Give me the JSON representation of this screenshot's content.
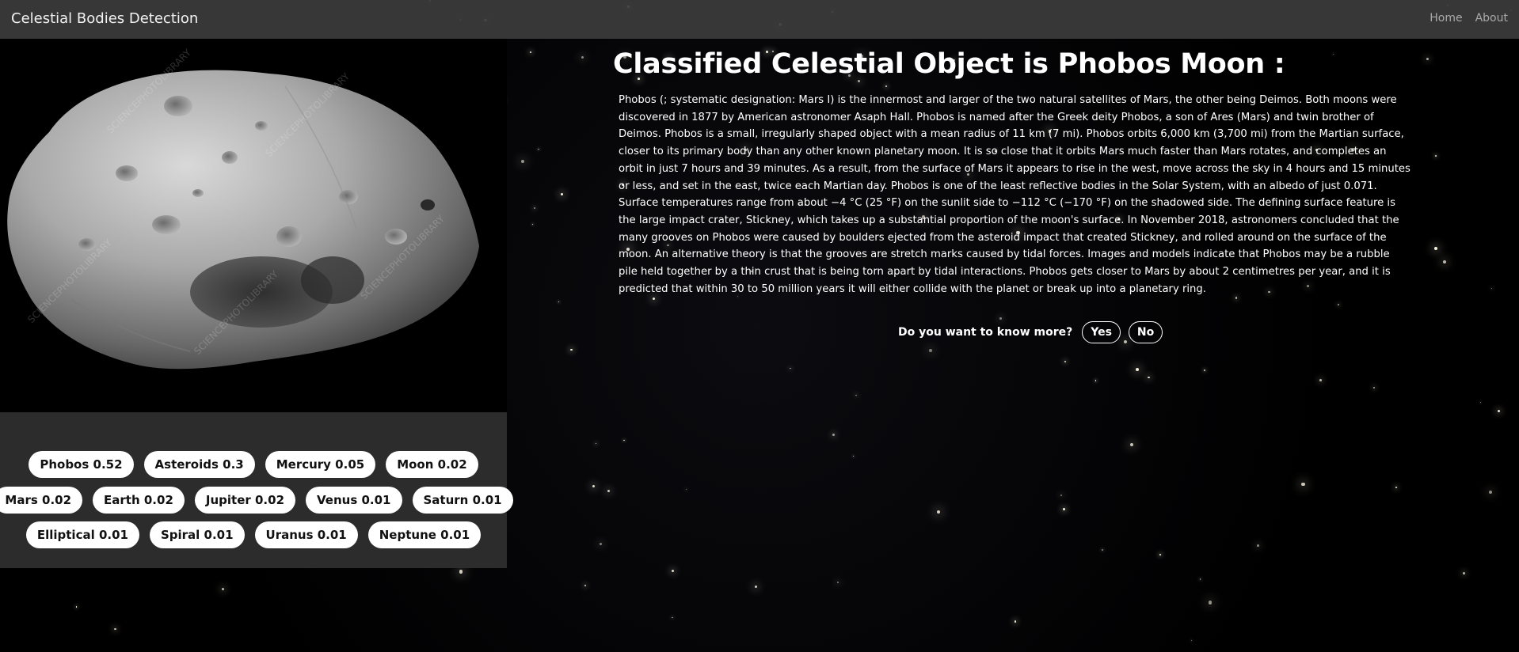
{
  "navbar": {
    "brand": "Celestial Bodies Detection",
    "links": [
      "Home",
      "About"
    ]
  },
  "classification": {
    "title": "Classified Celestial Object is Phobos Moon :",
    "description": "Phobos (; systematic designation: Mars I) is the innermost and larger of the two natural satellites of Mars, the other being Deimos. Both moons were discovered in 1877 by American astronomer Asaph Hall. Phobos is named after the Greek deity Phobos, a son of Ares (Mars) and twin brother of Deimos. Phobos is a small, irregularly shaped object with a mean radius of 11 km (7 mi). Phobos orbits 6,000 km (3,700 mi) from the Martian surface, closer to its primary body than any other known planetary moon. It is so close that it orbits Mars much faster than Mars rotates, and completes an orbit in just 7 hours and 39 minutes. As a result, from the surface of Mars it appears to rise in the west, move across the sky in 4 hours and 15 minutes or less, and set in the east, twice each Martian day. Phobos is one of the least reflective bodies in the Solar System, with an albedo of just 0.071. Surface temperatures range from about −4 °C (25 °F) on the sunlit side to −112 °C (−170 °F) on the shadowed side. The defining surface feature is the large impact crater, Stickney, which takes up a substantial proportion of the moon's surface. In November 2018, astronomers concluded that the many grooves on Phobos were caused by boulders ejected from the asteroid impact that created Stickney, and rolled around on the surface of the moon. An alternative theory is that the grooves are stretch marks caused by tidal forces. Images and models indicate that Phobos may be a rubble pile held together by a thin crust that is being torn apart by tidal interactions. Phobos gets closer to Mars by about 2 centimetres per year, and it is predicted that within 30 to 50 million years it will either collide with the planet or break up into a planetary ring."
  },
  "prompt": {
    "question": "Do you want to know more?",
    "yes_label": "Yes",
    "no_label": "No"
  },
  "predictions": [
    [
      "Phobos 0.52",
      "Asteroids 0.3",
      "Mercury 0.05",
      "Moon 0.02"
    ],
    [
      "Mars 0.02",
      "Earth 0.02",
      "Jupiter 0.02",
      "Venus 0.01",
      "Saturn 0.01"
    ],
    [
      "Elliptical 0.01",
      "Spiral 0.01",
      "Uranus 0.01",
      "Neptune 0.01"
    ]
  ],
  "image": {
    "subject": "phobos-moon",
    "watermark": "SCIENCEPHOTOLIBRARY"
  },
  "colors": {
    "navbar_bg": "#3c3c3c",
    "tags_panel_bg": "#2c2c2c",
    "tag_bg": "#ffffff",
    "tag_text": "#111111",
    "page_bg": "#000000"
  }
}
